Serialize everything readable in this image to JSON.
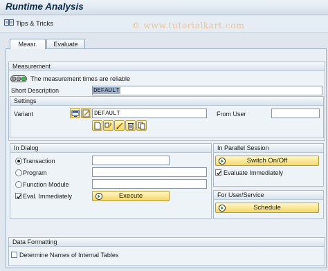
{
  "app": {
    "title": "Runtime Analysis"
  },
  "toolbar": {
    "tips_label": "Tips & Tricks"
  },
  "watermark": "© www.tutorialkart.com",
  "tabs": [
    {
      "label": "Measr."
    },
    {
      "label": "Evaluate"
    }
  ],
  "measurement": {
    "title": "Measurement",
    "status_text": "The measurement times are reliable",
    "short_description_label": "Short Description",
    "short_description_value": "DEFAULT"
  },
  "settings": {
    "title": "Settings",
    "variant_label": "Variant",
    "variant_value": "DEFAULT",
    "from_user_label": "From User",
    "from_user_value": ""
  },
  "in_dialog": {
    "title": "In Dialog",
    "options": [
      {
        "label": "Transaction",
        "selected": true
      },
      {
        "label": "Program",
        "selected": false
      },
      {
        "label": "Function Module",
        "selected": false
      }
    ],
    "eval_immediately_label": "Eval. Immediately",
    "eval_immediately_checked": true,
    "execute_label": "Execute"
  },
  "parallel": {
    "title": "In Parallel Session",
    "switch_label": "Switch On/Off",
    "evaluate_immediately_label": "Evaluate Immediately",
    "evaluate_immediately_checked": true
  },
  "user_service": {
    "title": "For User/Service",
    "schedule_label": "Schedule"
  },
  "data_formatting": {
    "title": "Data Formatting",
    "determine_names_label": "Determine Names of Internal Tables",
    "determine_names_checked": false
  }
}
